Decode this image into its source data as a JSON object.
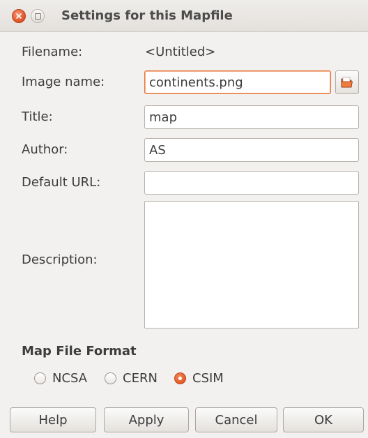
{
  "window": {
    "title": "Settings for this Mapfile"
  },
  "form": {
    "filename_label": "Filename:",
    "filename_value": "<Untitled>",
    "image_name_label": "Image name:",
    "image_name_value": "continents.png",
    "title_label": "Title:",
    "title_value": "map",
    "author_label": "Author:",
    "author_value": "AS",
    "default_url_label": "Default URL:",
    "default_url_value": "",
    "description_label": "Description:",
    "description_value": ""
  },
  "format": {
    "section_title": "Map File Format",
    "options": [
      {
        "label": "NCSA",
        "checked": false
      },
      {
        "label": "CERN",
        "checked": false
      },
      {
        "label": "CSIM",
        "checked": true
      }
    ]
  },
  "buttons": {
    "help": "Help",
    "apply": "Apply",
    "cancel": "Cancel",
    "ok": "OK"
  },
  "icons": {
    "window_close": "close-icon",
    "window_maximize": "maximize-icon",
    "browse": "folder-open-icon"
  },
  "colors": {
    "accent": "#e9753a",
    "radio_selected": "#e35a25",
    "window_bg": "#f2f1f0"
  }
}
